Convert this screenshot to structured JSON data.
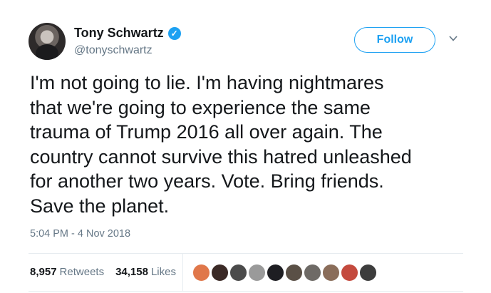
{
  "author": {
    "display_name": "Tony Schwartz",
    "handle": "@tonyschwartz",
    "verified_icon": "verified-badge-icon"
  },
  "follow_label": "Follow",
  "tweet": {
    "lines": [
      "I'm not going to lie. I'm having nightmares",
      "that we're going to experience the same",
      "trauma of Trump 2016 all over again. The",
      "country cannot survive this hatred unleashed",
      "for another two years. Vote. Bring friends.",
      "Save the planet."
    ],
    "timestamp": "5:04 PM - 4 Nov 2018"
  },
  "stats": {
    "retweets_count": "8,957",
    "retweets_label": "Retweets",
    "likes_count": "34,158",
    "likes_label": "Likes"
  },
  "likers": [
    {
      "color": "#e0774a"
    },
    {
      "color": "#3b2a26"
    },
    {
      "color": "#4b4b4b"
    },
    {
      "color": "#9a9a9a"
    },
    {
      "color": "#1e1e22"
    },
    {
      "color": "#5a5046"
    },
    {
      "color": "#6e6a66"
    },
    {
      "color": "#8a6d5a"
    },
    {
      "color": "#c44a3e"
    },
    {
      "color": "#3d3d3d"
    }
  ],
  "colors": {
    "accent": "#1da1f2",
    "text": "#14171a",
    "muted": "#657786"
  }
}
